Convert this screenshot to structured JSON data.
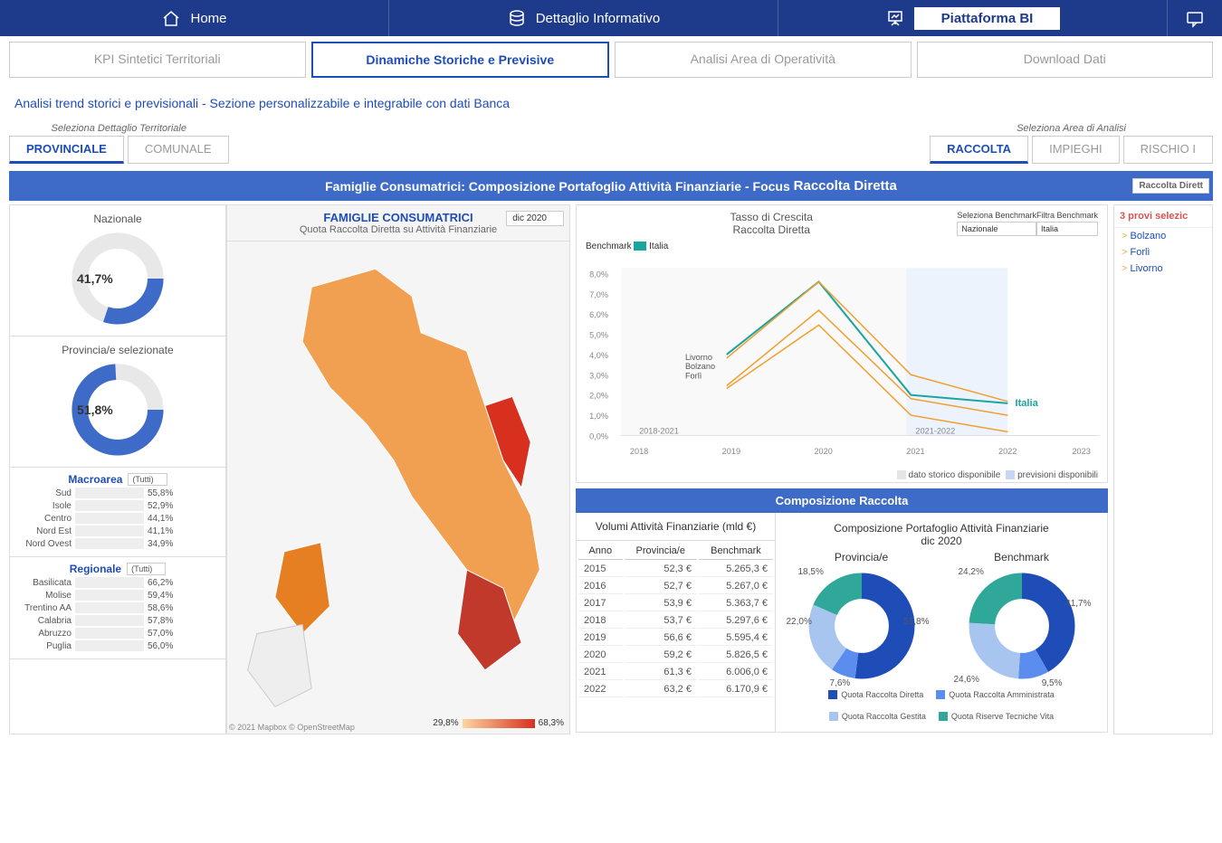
{
  "topnav": {
    "home": "Home",
    "dettaglio": "Dettaglio Informativo",
    "piattaforma": "Piattaforma BI"
  },
  "subnav": {
    "kpi": "KPI Sintetici Territoriali",
    "din": "Dinamiche Storiche e Previsive",
    "analisi": "Analisi Area di Operatività",
    "dl": "Download Dati"
  },
  "subtitle": "Analisi trend storici e previsionali - Sezione personalizzabile e integrabile con dati Banca",
  "sel_terr_label": "Seleziona Dettaglio Territoriale",
  "sel_terr": {
    "prov": "PROVINCIALE",
    "com": "COMUNALE"
  },
  "sel_area_label": "Seleziona Area di Analisi",
  "sel_area": {
    "rac": "RACCOLTA",
    "imp": "IMPIEGHI",
    "ris": "RISCHIO I"
  },
  "titlebar": {
    "pre": "Famiglie Consumatrici: Composizione Portafoglio Attività Finanziarie - Focus",
    "focus": "Raccolta Diretta",
    "dd": "Raccolta Dirett"
  },
  "map": {
    "t1": "FAMIGLIE CONSUMATRICI",
    "t2": "Quota Raccolta Diretta su Attività Finanziarie",
    "dd": "dic 2020",
    "cred": "© 2021 Mapbox © OpenStreetMap",
    "leg_lo": "29,8%",
    "leg_hi": "68,3%"
  },
  "gauges": {
    "naz_lbl": "Nazionale",
    "naz_val": "41,7%",
    "prov_lbl": "Provincia/e selezionate",
    "prov_val": "51,8%"
  },
  "macro": {
    "hdr": "Macroarea",
    "dd": "(Tutti)",
    "rows": [
      {
        "l": "Sud",
        "v": "55,8%",
        "p": 84
      },
      {
        "l": "Isole",
        "v": "52,9%",
        "p": 80
      },
      {
        "l": "Centro",
        "v": "44,1%",
        "p": 66
      },
      {
        "l": "Nord Est",
        "v": "41,1%",
        "p": 62
      },
      {
        "l": "Nord Ovest",
        "v": "34,9%",
        "p": 53
      }
    ]
  },
  "reg": {
    "hdr": "Regionale",
    "dd": "(Tutti)",
    "rows": [
      {
        "l": "Basilicata",
        "v": "66,2%",
        "p": 100
      },
      {
        "l": "Molise",
        "v": "59,4%",
        "p": 90
      },
      {
        "l": "Trentino AA",
        "v": "58,6%",
        "p": 88
      },
      {
        "l": "Calabria",
        "v": "57,8%",
        "p": 87
      },
      {
        "l": "Abruzzo",
        "v": "57,0%",
        "p": 86
      },
      {
        "l": "Puglia",
        "v": "56,0%",
        "p": 85
      }
    ]
  },
  "growth": {
    "t1": "Tasso di Crescita",
    "t2": "Raccolta Diretta",
    "bench_lbl": "Seleziona Benchmark",
    "bench_v": "Nazionale",
    "filt_lbl": "Filtra Benchmark",
    "filt_v": "Italia",
    "legend": "Benchmark",
    "legend_it": "Italia",
    "ann1": "Livorno",
    "ann2": "Bolzano",
    "ann3": "Forlì",
    "ann_it": "Italia",
    "span1": "2018-2021",
    "span2": "2021-2022",
    "leg_hist": "dato storico disponibile",
    "leg_prev": "previsioni disponibili"
  },
  "comp": {
    "hdr": "Composizione Raccolta"
  },
  "vol": {
    "th": "Volumi Attività Finanziarie\n(mld €)",
    "h1": "Anno",
    "h2": "Provincia/e",
    "h3": "Benchmark",
    "rows": [
      [
        "2015",
        "52,3 €",
        "5.265,3 €"
      ],
      [
        "2016",
        "52,7 €",
        "5.267,0 €"
      ],
      [
        "2017",
        "53,9 €",
        "5.363,7 €"
      ],
      [
        "2018",
        "53,7 €",
        "5.297,6 €"
      ],
      [
        "2019",
        "56,6 €",
        "5.595,4 €"
      ],
      [
        "2020",
        "59,2 €",
        "5.826,5 €"
      ],
      [
        "2021",
        "61,3 €",
        "6.006,0 €"
      ],
      [
        "2022",
        "63,2 €",
        "6.170,9 €"
      ]
    ]
  },
  "donuts": {
    "dh1": "Composizione Portafoglio Attività Finanziarie",
    "dh2": "dic 2020",
    "prov": "Provincia/e",
    "bench": "Benchmark",
    "prov_v": {
      "a": "51,8%",
      "b": "7,6%",
      "c": "22,0%",
      "d": "18,5%"
    },
    "bench_v": {
      "a": "41,7%",
      "b": "9,5%",
      "c": "24,6%",
      "d": "24,2%"
    },
    "leg": [
      "Quota Raccolta Diretta",
      "Quota Raccolta Amministrata",
      "Quota Raccolta Gestita",
      "Quota Riserve Tecniche Vita"
    ]
  },
  "rside": {
    "hdr": "3 provi\nselezic",
    "items": [
      "Bolzano",
      "Forlì",
      "Livorno"
    ]
  },
  "chart_data": {
    "growth_line": {
      "type": "line",
      "x": [
        2018,
        2019,
        2020,
        2021,
        2022,
        2023
      ],
      "ylim": [
        0,
        8
      ],
      "ylabel": "%",
      "series": [
        {
          "name": "Italia (Benchmark)",
          "values": [
            null,
            4.0,
            7.6,
            2.0,
            1.6,
            null
          ],
          "color": "#1aa5a0"
        },
        {
          "name": "Livorno",
          "values": [
            null,
            3.8,
            7.6,
            3.0,
            1.7,
            null
          ],
          "color": "#f0a030"
        },
        {
          "name": "Bolzano",
          "values": [
            null,
            2.5,
            6.2,
            1.8,
            1.0,
            null
          ],
          "color": "#f0a030"
        },
        {
          "name": "Forlì",
          "values": [
            null,
            2.4,
            5.5,
            1.0,
            0.2,
            null
          ],
          "color": "#f0a030"
        }
      ],
      "yticks": [
        "0,0%",
        "1,0%",
        "2,0%",
        "3,0%",
        "4,0%",
        "5,0%",
        "6,0%",
        "7,0%",
        "8,0%"
      ]
    },
    "macro_bars": {
      "type": "bar",
      "categories": [
        "Sud",
        "Isole",
        "Centro",
        "Nord Est",
        "Nord Ovest"
      ],
      "values": [
        55.8,
        52.9,
        44.1,
        41.1,
        34.9
      ]
    },
    "reg_bars": {
      "type": "bar",
      "categories": [
        "Basilicata",
        "Molise",
        "Trentino AA",
        "Calabria",
        "Abruzzo",
        "Puglia"
      ],
      "values": [
        66.2,
        59.4,
        58.6,
        57.8,
        57.0,
        56.0
      ]
    },
    "donut_prov": {
      "type": "pie",
      "labels": [
        "Raccolta Diretta",
        "Raccolta Amministrata",
        "Raccolta Gestita",
        "Riserve Tecniche Vita"
      ],
      "values": [
        51.8,
        7.6,
        22.0,
        18.5
      ]
    },
    "donut_bench": {
      "type": "pie",
      "labels": [
        "Raccolta Diretta",
        "Raccolta Amministrata",
        "Raccolta Gestita",
        "Riserve Tecniche Vita"
      ],
      "values": [
        41.7,
        9.5,
        24.6,
        24.2
      ]
    },
    "gauge_naz": 41.7,
    "gauge_prov": 51.8,
    "map_scale": [
      29.8,
      68.3
    ]
  }
}
